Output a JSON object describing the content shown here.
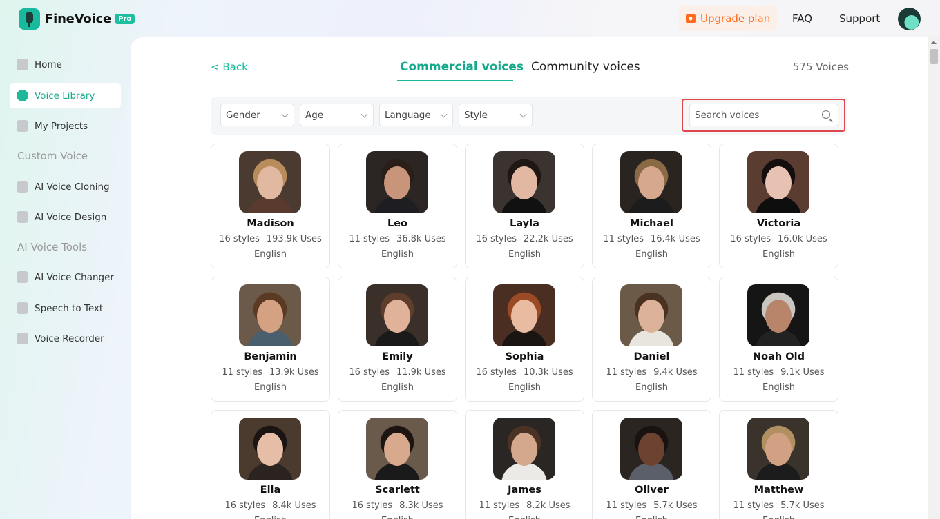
{
  "brand": {
    "name": "FineVoice",
    "badge": "Pro"
  },
  "header": {
    "upgrade_label": "Upgrade plan",
    "faq_label": "FAQ",
    "support_label": "Support"
  },
  "sidebar": {
    "items": [
      {
        "label": "Home",
        "icon": "home-icon"
      },
      {
        "label": "Voice Library",
        "icon": "voice-library-icon",
        "active": true
      },
      {
        "label": "My Projects",
        "icon": "projects-icon"
      }
    ],
    "custom_voice_title": "Custom Voice",
    "custom_items": [
      {
        "label": "AI Voice Cloning",
        "icon": "voice-cloning-icon"
      },
      {
        "label": "AI Voice Design",
        "icon": "voice-design-icon"
      }
    ],
    "tools_title": "AI Voice Tools",
    "tools_items": [
      {
        "label": "AI Voice Changer",
        "icon": "microphone-icon"
      },
      {
        "label": "Speech to Text",
        "icon": "speech-to-text-icon"
      },
      {
        "label": "Voice Recorder",
        "icon": "recorder-icon"
      }
    ]
  },
  "main": {
    "back_label": "< Back",
    "tabs": [
      {
        "label": "Commercial voices",
        "active": true
      },
      {
        "label": "Community voices"
      }
    ],
    "voice_count": "575 Voices",
    "filters": [
      "Gender",
      "Age",
      "Language",
      "Style"
    ],
    "search": {
      "placeholder": "Search voices",
      "value": ""
    },
    "voices": [
      {
        "name": "Madison",
        "styles": "16 styles",
        "uses": "193.9k Uses",
        "language": "English",
        "skin": "#e0b9a0",
        "hair": "#b98c5c",
        "bg": "#4a3a30",
        "cloth": "#5a3a2e"
      },
      {
        "name": "Leo",
        "styles": "11 styles",
        "uses": "36.8k Uses",
        "language": "English",
        "skin": "#c9957a",
        "hair": "#2a1f18",
        "bg": "#2b2624",
        "cloth": "#1e1e22"
      },
      {
        "name": "Layla",
        "styles": "16 styles",
        "uses": "22.2k Uses",
        "language": "English",
        "skin": "#e3b8a3",
        "hair": "#1f1714",
        "bg": "#3a3330",
        "cloth": "#111"
      },
      {
        "name": "Michael",
        "styles": "11 styles",
        "uses": "16.4k Uses",
        "language": "English",
        "skin": "#d6a88d",
        "hair": "#8a6a45",
        "bg": "#2a2420",
        "cloth": "#1c1c1c"
      },
      {
        "name": "Victoria",
        "styles": "16 styles",
        "uses": "16.0k Uses",
        "language": "English",
        "skin": "#e7c2b3",
        "hair": "#140f0e",
        "bg": "#5a3d30",
        "cloth": "#0e0e0e"
      },
      {
        "name": "Benjamin",
        "styles": "11 styles",
        "uses": "13.9k Uses",
        "language": "English",
        "skin": "#d4a283",
        "hair": "#5b3a24",
        "bg": "#6b5a4a",
        "cloth": "#4a5f6e"
      },
      {
        "name": "Emily",
        "styles": "16 styles",
        "uses": "11.9k Uses",
        "language": "English",
        "skin": "#e0b29a",
        "hair": "#5e3d2a",
        "bg": "#3b2f2a",
        "cloth": "#1a1a1a"
      },
      {
        "name": "Sophia",
        "styles": "16 styles",
        "uses": "10.3k Uses",
        "language": "English",
        "skin": "#e9bca2",
        "hair": "#9a4a24",
        "bg": "#4a2e22",
        "cloth": "#1a1512"
      },
      {
        "name": "Daniel",
        "styles": "11 styles",
        "uses": "9.4k Uses",
        "language": "English",
        "skin": "#dcb39a",
        "hair": "#4a3222",
        "bg": "#6c5a48",
        "cloth": "#e8e4de"
      },
      {
        "name": "Noah Old",
        "styles": "11 styles",
        "uses": "9.1k Uses",
        "language": "English",
        "skin": "#b8856a",
        "hair": "#c9c5c0",
        "bg": "#151515",
        "cloth": "#222"
      },
      {
        "name": "Ella",
        "styles": "16 styles",
        "uses": "8.4k Uses",
        "language": "English",
        "skin": "#e6bda6",
        "hair": "#1a1412",
        "bg": "#4b3a2e",
        "cloth": "#2a2320"
      },
      {
        "name": "Scarlett",
        "styles": "16 styles",
        "uses": "8.3k Uses",
        "language": "English",
        "skin": "#d9a98e",
        "hair": "#1c1512",
        "bg": "#6a5a4c",
        "cloth": "#1a1a1a"
      },
      {
        "name": "James",
        "styles": "11 styles",
        "uses": "8.2k Uses",
        "language": "English",
        "skin": "#d4a88c",
        "hair": "#4a3324",
        "bg": "#2a2624",
        "cloth": "#eceae6"
      },
      {
        "name": "Oliver",
        "styles": "11 styles",
        "uses": "5.7k Uses",
        "language": "English",
        "skin": "#6b4330",
        "hair": "#1a1210",
        "bg": "#2a2520",
        "cloth": "#5a5f6a"
      },
      {
        "name": "Matthew",
        "styles": "11 styles",
        "uses": "5.7k Uses",
        "language": "English",
        "skin": "#d2a184",
        "hair": "#b09060",
        "bg": "#3a332c",
        "cloth": "#1c1c1c"
      }
    ]
  }
}
